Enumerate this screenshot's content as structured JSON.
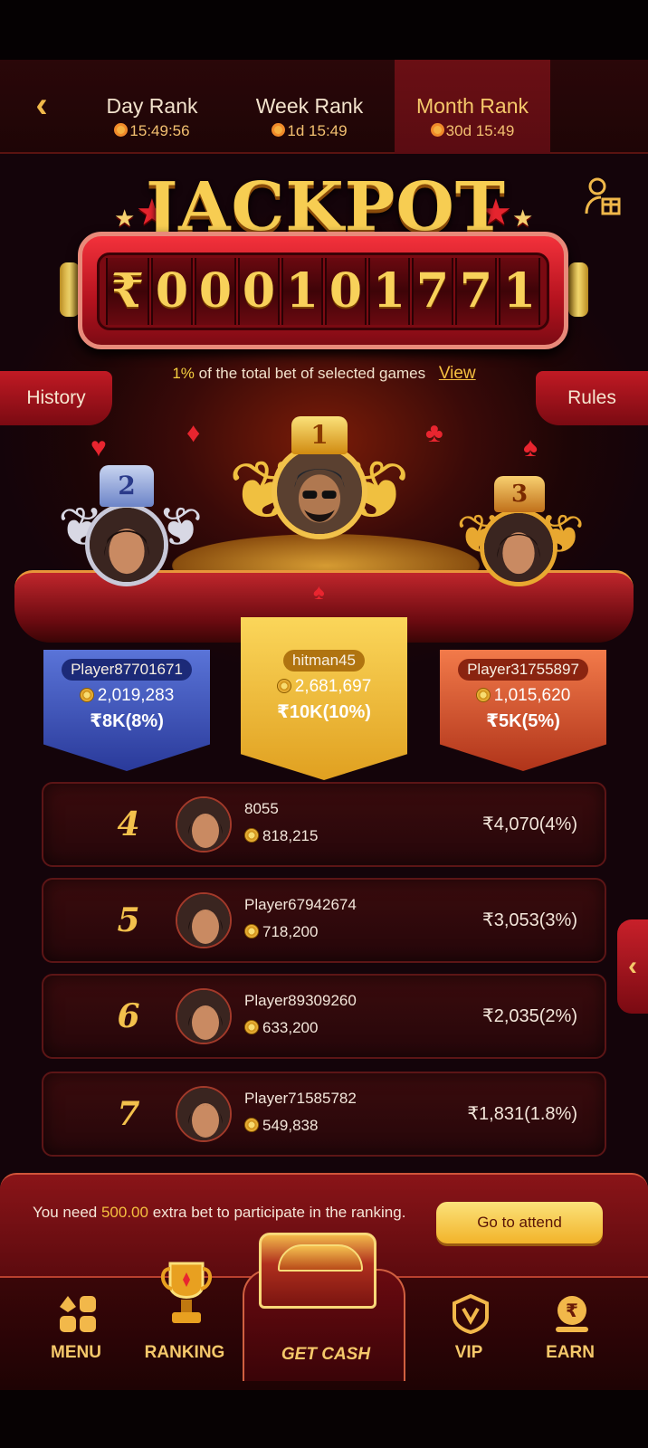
{
  "tabs": [
    {
      "label": "Day Rank",
      "timer": "15:49:56"
    },
    {
      "label": "Week Rank",
      "timer": "1d 15:49"
    },
    {
      "label": "Month Rank",
      "timer": "30d 15:49"
    }
  ],
  "jackpot": {
    "title": "JACKPOT",
    "currency": "₹",
    "digits": [
      "0",
      "0",
      "0",
      "1",
      "0",
      "1",
      "7",
      "7",
      "1"
    ]
  },
  "info": {
    "percent": "1%",
    "text": "of the total bet of selected games",
    "view_label": "View"
  },
  "side_buttons": {
    "history": "History",
    "rules": "Rules"
  },
  "podium": [
    {
      "rank": "2",
      "name": "Player87701671",
      "coins": "2,019,283",
      "reward": "₹8K(8%)"
    },
    {
      "rank": "1",
      "name": "hitman45",
      "coins": "2,681,697",
      "reward": "₹10K(10%)"
    },
    {
      "rank": "3",
      "name": "Player31755897",
      "coins": "1,015,620",
      "reward": "₹5K(5%)"
    }
  ],
  "rows": [
    {
      "rank": "4",
      "name": "8055",
      "coins": "818,215",
      "prize": "₹4,070(4%)"
    },
    {
      "rank": "5",
      "name": "Player67942674",
      "coins": "718,200",
      "prize": "₹3,053(3%)"
    },
    {
      "rank": "6",
      "name": "Player89309260",
      "coins": "633,200",
      "prize": "₹2,035(2%)"
    },
    {
      "rank": "7",
      "name": "Player71585782",
      "coins": "549,838",
      "prize": "₹1,831(1.8%)"
    }
  ],
  "participation": {
    "prefix": "You need",
    "amount": "500.00",
    "suffix": "extra bet to participate in the ranking.",
    "button": "Go to attend"
  },
  "nav": {
    "menu": "MENU",
    "ranking": "RANKING",
    "get_cash": "GET CASH",
    "vip": "VIP",
    "earn": "EARN"
  },
  "colors": {
    "accent_gold": "#f5c86a",
    "active_tab": "#5a0c12",
    "rank2_plaque": "#3a4fb0",
    "rank1_plaque": "#e8a820",
    "rank3_plaque": "#c0401e"
  }
}
